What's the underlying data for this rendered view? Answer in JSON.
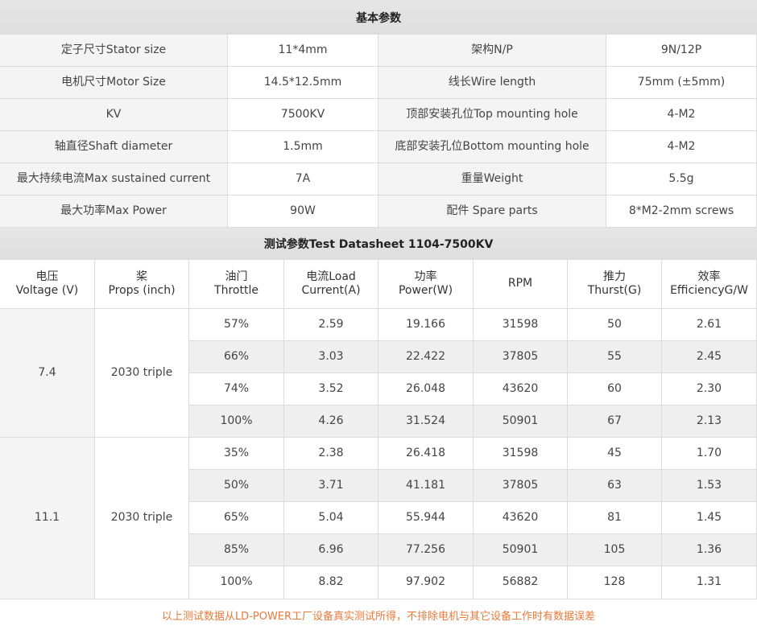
{
  "basic": {
    "title": "基本参数",
    "rows": [
      [
        "定子尺寸Stator size",
        "11*4mm",
        "架构N/P",
        "9N/12P"
      ],
      [
        "电机尺寸Motor Size",
        "14.5*12.5mm",
        "线长Wire length",
        "75mm (±5mm)"
      ],
      [
        "KV",
        "7500KV",
        "顶部安装孔位Top mounting hole",
        "4-M2"
      ],
      [
        "轴直径Shaft diameter",
        "1.5mm",
        "底部安装孔位Bottom mounting hole",
        "4-M2"
      ],
      [
        "最大持续电流Max sustained current",
        "7A",
        "重量Weight",
        "5.5g"
      ],
      [
        "最大功率Max Power",
        "90W",
        "配件 Spare parts",
        "8*M2-2mm screws"
      ]
    ]
  },
  "test": {
    "title": "测试参数Test Datasheet 1104-7500KV",
    "headers": [
      [
        "电压",
        "Voltage (V)"
      ],
      [
        "桨",
        "Props (inch)"
      ],
      [
        "油门",
        "Throttle"
      ],
      [
        "电流Load",
        "Current(A)"
      ],
      [
        "功率",
        "Power(W)"
      ],
      [
        "RPM",
        ""
      ],
      [
        "推力",
        "Thurst(G)"
      ],
      [
        "效率",
        "EfficiencyG/W"
      ]
    ],
    "groups": [
      {
        "voltage": "7.4",
        "props": "2030 triple",
        "rows": [
          [
            "57%",
            "2.59",
            "19.166",
            "31598",
            "50",
            "2.61"
          ],
          [
            "66%",
            "3.03",
            "22.422",
            "37805",
            "55",
            "2.45"
          ],
          [
            "74%",
            "3.52",
            "26.048",
            "43620",
            "60",
            "2.30"
          ],
          [
            "100%",
            "4.26",
            "31.524",
            "50901",
            "67",
            "2.13"
          ]
        ]
      },
      {
        "voltage": "11.1",
        "props": "2030 triple",
        "rows": [
          [
            "35%",
            "2.38",
            "26.418",
            "31598",
            "45",
            "1.70"
          ],
          [
            "50%",
            "3.71",
            "41.181",
            "37805",
            "63",
            "1.53"
          ],
          [
            "65%",
            "5.04",
            "55.944",
            "43620",
            "81",
            "1.45"
          ],
          [
            "85%",
            "6.96",
            "77.256",
            "50901",
            "105",
            "1.36"
          ],
          [
            "100%",
            "8.82",
            "97.902",
            "56882",
            "128",
            "1.31"
          ]
        ]
      }
    ]
  },
  "footer": {
    "note": "以上测试数据从LD-POWER工厂设备真实测试所得，不排除电机与其它设备工作时有数据误差"
  },
  "colors": {
    "footer_text": "#e87a3a",
    "header_bg": "#e2e2e2"
  }
}
